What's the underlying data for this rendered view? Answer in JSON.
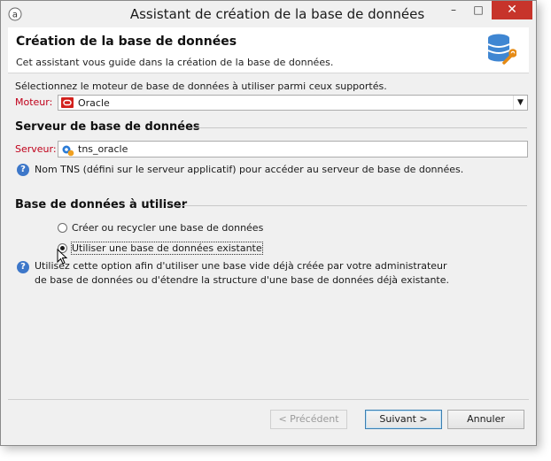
{
  "window": {
    "title": "Assistant de création de la base de données",
    "controls": {
      "minimize": "–",
      "maximize": "□",
      "close": "✕"
    }
  },
  "header": {
    "title": "Création de la base de données",
    "subtitle": "Cet assistant vous guide dans la création de la base de données.",
    "icon": "database-wrench-icon"
  },
  "engine": {
    "intro": "Sélectionnez le moteur de base de données à utiliser parmi ceux supportés.",
    "label": "Moteur:",
    "value": "Oracle"
  },
  "server_section": {
    "title": "Serveur de base de données",
    "label": "Serveur:",
    "value": "tns_oracle",
    "help": "Nom TNS (défini sur le serveur applicatif) pour accéder au serveur de base de données."
  },
  "db_section": {
    "title": "Base de données à utiliser",
    "options": [
      {
        "label": "Créer ou recycler une base de données",
        "selected": false
      },
      {
        "label": "Utiliser une base de données existante",
        "selected": true
      }
    ],
    "help_line1": "Utilisez cette option afin d'utiliser une base vide déjà créée par votre administrateur",
    "help_line2": "de base de données ou d'étendre la structure d'une base de données déjà existante."
  },
  "footer": {
    "previous": "< Précédent",
    "next": "Suivant >",
    "cancel": "Annuler"
  },
  "colors": {
    "required_label": "#c0001a",
    "help_icon": "#3d77c9",
    "close_button": "#c7342b"
  }
}
